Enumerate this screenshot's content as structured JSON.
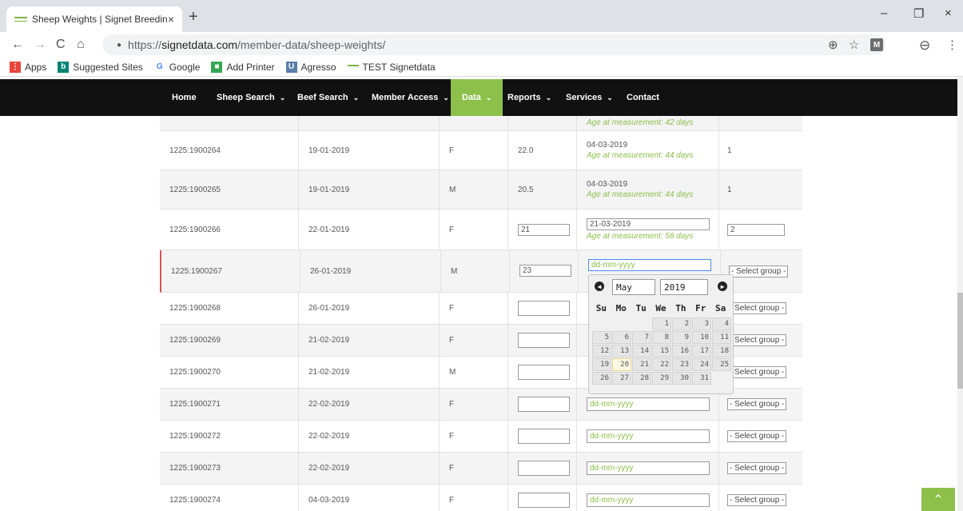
{
  "browser": {
    "tab_title": "Sheep Weights | Signet Breeding",
    "tab_close": "×",
    "new_tab": "+",
    "url_scheme": "https://",
    "url_host": "signetdata.com",
    "url_path": "/member-data/sheep-weights/",
    "win_minimize": "–",
    "win_restore": "❐",
    "win_close": "×",
    "back": "←",
    "forward": "→",
    "reload": "C",
    "home": "⌂",
    "zoom": "⊕",
    "star": "☆",
    "ext_badge": "M",
    "profile": "⊖",
    "menu": "⋮"
  },
  "bookmarks": [
    {
      "label": "Apps",
      "icon": "apps-grid-icon",
      "color": "#e8453c"
    },
    {
      "label": "Suggested Sites",
      "icon": "bing-icon",
      "color": "#008373"
    },
    {
      "label": "Google",
      "icon": "google-icon",
      "color": "#4285f4"
    },
    {
      "label": "Add Printer",
      "icon": "printer-icon",
      "color": "#34a853"
    },
    {
      "label": "Agresso",
      "icon": "agresso-icon",
      "color": "#5a7fa8"
    },
    {
      "label": "TEST Signetdata",
      "icon": "signet-icon",
      "color": "#7db346"
    }
  ],
  "nav": {
    "home": "Home",
    "sheep_search": "Sheep Search",
    "beef_search": "Beef Search",
    "member_access": "Member Access",
    "data": "Data",
    "reports": "Reports",
    "services": "Services",
    "contact": "Contact",
    "chevron": "⌄"
  },
  "top_partial": {
    "age": "Age at measurement: 42 days"
  },
  "rows": [
    {
      "id": "1225:1900264",
      "dob": "19-01-2019",
      "sex": "F",
      "weight": "22.0",
      "date": "04-03-2019",
      "age": "Age at measurement: 44 days",
      "group": "1"
    },
    {
      "id": "1225:1900265",
      "dob": "19-01-2019",
      "sex": "M",
      "weight": "20.5",
      "date": "04-03-2019",
      "age": "Age at measurement: 44 days",
      "group": "1"
    },
    {
      "id": "1225:1900266",
      "dob": "22-01-2019",
      "sex": "F",
      "weight": "21",
      "date": "21-03-2019",
      "age": "Age at measurement: 58 days",
      "group": "2"
    },
    {
      "id": "1225:1900267",
      "dob": "26-01-2019",
      "sex": "M",
      "weight": "23",
      "date_placeholder": "dd-mm-yyyy",
      "group_select": "- Select group -"
    },
    {
      "id": "1225:1900268",
      "dob": "26-01-2019",
      "sex": "F",
      "group_select": "- Select group -"
    },
    {
      "id": "1225:1900269",
      "dob": "21-02-2019",
      "sex": "F",
      "group_select": "- Select group -"
    },
    {
      "id": "1225:1900270",
      "dob": "21-02-2019",
      "sex": "M",
      "group_select": "- Select group -"
    },
    {
      "id": "1225:1900271",
      "dob": "22-02-2019",
      "sex": "F",
      "date_placeholder": "dd-mm-yyyy",
      "group_select": "- Select group -"
    },
    {
      "id": "1225:1900272",
      "dob": "22-02-2019",
      "sex": "F",
      "date_placeholder": "dd-mm-yyyy",
      "group_select": "- Select group -"
    },
    {
      "id": "1225:1900273",
      "dob": "22-02-2019",
      "sex": "F",
      "date_placeholder": "dd-mm-yyyy",
      "group_select": "- Select group -"
    },
    {
      "id": "1225:1900274",
      "dob": "04-03-2019",
      "sex": "F",
      "date_placeholder": "dd-mm-yyyy",
      "group_select": "- Select group -"
    }
  ],
  "datepicker": {
    "prev": "◀",
    "next": "▶",
    "month": "May",
    "year": "2019",
    "weekdays": [
      "Su",
      "Mo",
      "Tu",
      "We",
      "Th",
      "Fr",
      "Sa"
    ],
    "lead_blanks": 3,
    "days": [
      "1",
      "2",
      "3",
      "4",
      "5",
      "6",
      "7",
      "8",
      "9",
      "10",
      "11",
      "12",
      "13",
      "14",
      "15",
      "16",
      "17",
      "18",
      "19",
      "20",
      "21",
      "22",
      "23",
      "24",
      "25",
      "26",
      "27",
      "28",
      "29",
      "30",
      "31"
    ],
    "today": "20"
  },
  "colors": {
    "accent": "#8cc04b",
    "nav_bg": "#111111"
  },
  "back_to_top": "⌃"
}
